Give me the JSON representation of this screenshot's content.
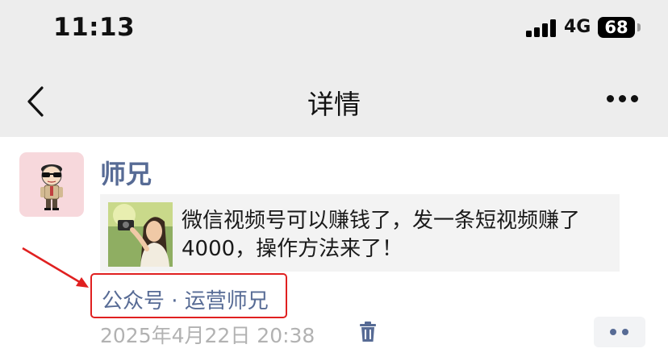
{
  "status_bar": {
    "time": "11:13",
    "network": "4G",
    "battery": "68"
  },
  "nav": {
    "title": "详情",
    "back_icon": "chevron-left-icon",
    "more_icon": "more-horizontal-icon"
  },
  "post": {
    "author": "师兄",
    "shared_article": {
      "title": "微信视频号可以赚钱了，发一条短视频赚了4000，操作方法来了！"
    },
    "source": "公众号 · 运营师兄",
    "timestamp": "2025年4月22日 20:38"
  },
  "colors": {
    "link_blue": "#576b95",
    "highlight_red": "#e02020",
    "nav_bg": "#ededed"
  }
}
